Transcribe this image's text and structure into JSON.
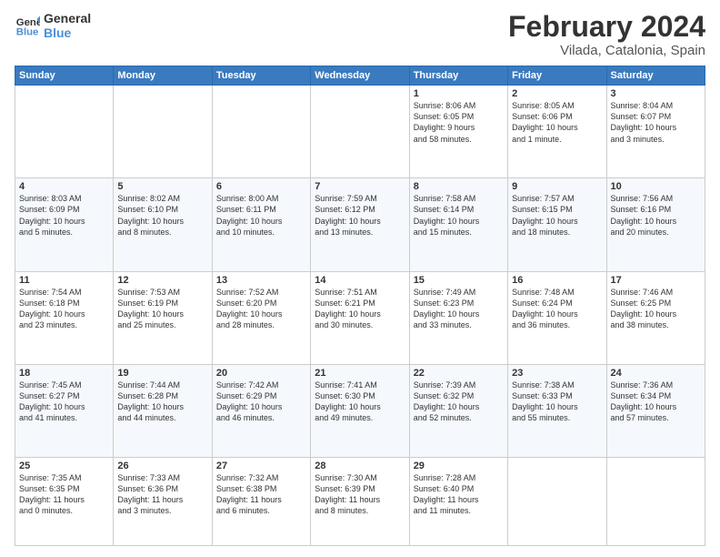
{
  "logo": {
    "line1": "General",
    "line2": "Blue"
  },
  "header": {
    "title": "February 2024",
    "subtitle": "Vilada, Catalonia, Spain"
  },
  "weekdays": [
    "Sunday",
    "Monday",
    "Tuesday",
    "Wednesday",
    "Thursday",
    "Friday",
    "Saturday"
  ],
  "weeks": [
    [
      {
        "day": "",
        "info": ""
      },
      {
        "day": "",
        "info": ""
      },
      {
        "day": "",
        "info": ""
      },
      {
        "day": "",
        "info": ""
      },
      {
        "day": "1",
        "info": "Sunrise: 8:06 AM\nSunset: 6:05 PM\nDaylight: 9 hours\nand 58 minutes."
      },
      {
        "day": "2",
        "info": "Sunrise: 8:05 AM\nSunset: 6:06 PM\nDaylight: 10 hours\nand 1 minute."
      },
      {
        "day": "3",
        "info": "Sunrise: 8:04 AM\nSunset: 6:07 PM\nDaylight: 10 hours\nand 3 minutes."
      }
    ],
    [
      {
        "day": "4",
        "info": "Sunrise: 8:03 AM\nSunset: 6:09 PM\nDaylight: 10 hours\nand 5 minutes."
      },
      {
        "day": "5",
        "info": "Sunrise: 8:02 AM\nSunset: 6:10 PM\nDaylight: 10 hours\nand 8 minutes."
      },
      {
        "day": "6",
        "info": "Sunrise: 8:00 AM\nSunset: 6:11 PM\nDaylight: 10 hours\nand 10 minutes."
      },
      {
        "day": "7",
        "info": "Sunrise: 7:59 AM\nSunset: 6:12 PM\nDaylight: 10 hours\nand 13 minutes."
      },
      {
        "day": "8",
        "info": "Sunrise: 7:58 AM\nSunset: 6:14 PM\nDaylight: 10 hours\nand 15 minutes."
      },
      {
        "day": "9",
        "info": "Sunrise: 7:57 AM\nSunset: 6:15 PM\nDaylight: 10 hours\nand 18 minutes."
      },
      {
        "day": "10",
        "info": "Sunrise: 7:56 AM\nSunset: 6:16 PM\nDaylight: 10 hours\nand 20 minutes."
      }
    ],
    [
      {
        "day": "11",
        "info": "Sunrise: 7:54 AM\nSunset: 6:18 PM\nDaylight: 10 hours\nand 23 minutes."
      },
      {
        "day": "12",
        "info": "Sunrise: 7:53 AM\nSunset: 6:19 PM\nDaylight: 10 hours\nand 25 minutes."
      },
      {
        "day": "13",
        "info": "Sunrise: 7:52 AM\nSunset: 6:20 PM\nDaylight: 10 hours\nand 28 minutes."
      },
      {
        "day": "14",
        "info": "Sunrise: 7:51 AM\nSunset: 6:21 PM\nDaylight: 10 hours\nand 30 minutes."
      },
      {
        "day": "15",
        "info": "Sunrise: 7:49 AM\nSunset: 6:23 PM\nDaylight: 10 hours\nand 33 minutes."
      },
      {
        "day": "16",
        "info": "Sunrise: 7:48 AM\nSunset: 6:24 PM\nDaylight: 10 hours\nand 36 minutes."
      },
      {
        "day": "17",
        "info": "Sunrise: 7:46 AM\nSunset: 6:25 PM\nDaylight: 10 hours\nand 38 minutes."
      }
    ],
    [
      {
        "day": "18",
        "info": "Sunrise: 7:45 AM\nSunset: 6:27 PM\nDaylight: 10 hours\nand 41 minutes."
      },
      {
        "day": "19",
        "info": "Sunrise: 7:44 AM\nSunset: 6:28 PM\nDaylight: 10 hours\nand 44 minutes."
      },
      {
        "day": "20",
        "info": "Sunrise: 7:42 AM\nSunset: 6:29 PM\nDaylight: 10 hours\nand 46 minutes."
      },
      {
        "day": "21",
        "info": "Sunrise: 7:41 AM\nSunset: 6:30 PM\nDaylight: 10 hours\nand 49 minutes."
      },
      {
        "day": "22",
        "info": "Sunrise: 7:39 AM\nSunset: 6:32 PM\nDaylight: 10 hours\nand 52 minutes."
      },
      {
        "day": "23",
        "info": "Sunrise: 7:38 AM\nSunset: 6:33 PM\nDaylight: 10 hours\nand 55 minutes."
      },
      {
        "day": "24",
        "info": "Sunrise: 7:36 AM\nSunset: 6:34 PM\nDaylight: 10 hours\nand 57 minutes."
      }
    ],
    [
      {
        "day": "25",
        "info": "Sunrise: 7:35 AM\nSunset: 6:35 PM\nDaylight: 11 hours\nand 0 minutes."
      },
      {
        "day": "26",
        "info": "Sunrise: 7:33 AM\nSunset: 6:36 PM\nDaylight: 11 hours\nand 3 minutes."
      },
      {
        "day": "27",
        "info": "Sunrise: 7:32 AM\nSunset: 6:38 PM\nDaylight: 11 hours\nand 6 minutes."
      },
      {
        "day": "28",
        "info": "Sunrise: 7:30 AM\nSunset: 6:39 PM\nDaylight: 11 hours\nand 8 minutes."
      },
      {
        "day": "29",
        "info": "Sunrise: 7:28 AM\nSunset: 6:40 PM\nDaylight: 11 hours\nand 11 minutes."
      },
      {
        "day": "",
        "info": ""
      },
      {
        "day": "",
        "info": ""
      }
    ]
  ]
}
